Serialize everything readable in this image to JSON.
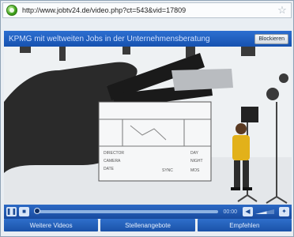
{
  "browser": {
    "url": "http://www.jobtv24.de/video.php?ct=543&vid=17809",
    "star_icon": "star-outline-icon",
    "site_icon": "green-globe-icon"
  },
  "player": {
    "title": "KPMG mit weltweiten Jobs in der Unternehmensberatung",
    "block_button": "Blockieren",
    "controls": {
      "play_icon": "pause-icon",
      "stop_icon": "stop-icon",
      "time": "00:00",
      "progress": 0.0,
      "volume_icon": "speaker-icon",
      "fullscreen_icon": "fullscreen-icon"
    },
    "clapper_text": [
      "DIRECTOR",
      "CAMERA",
      "DATE",
      "DAY",
      "NIGHT",
      "SYNC",
      "MOS"
    ]
  },
  "tabs": [
    "Weitere Videos",
    "Stellenangebote",
    "Empfehlen"
  ],
  "colors": {
    "player_blue": "#1f5fc0",
    "title_text": "#cfe0ff"
  }
}
